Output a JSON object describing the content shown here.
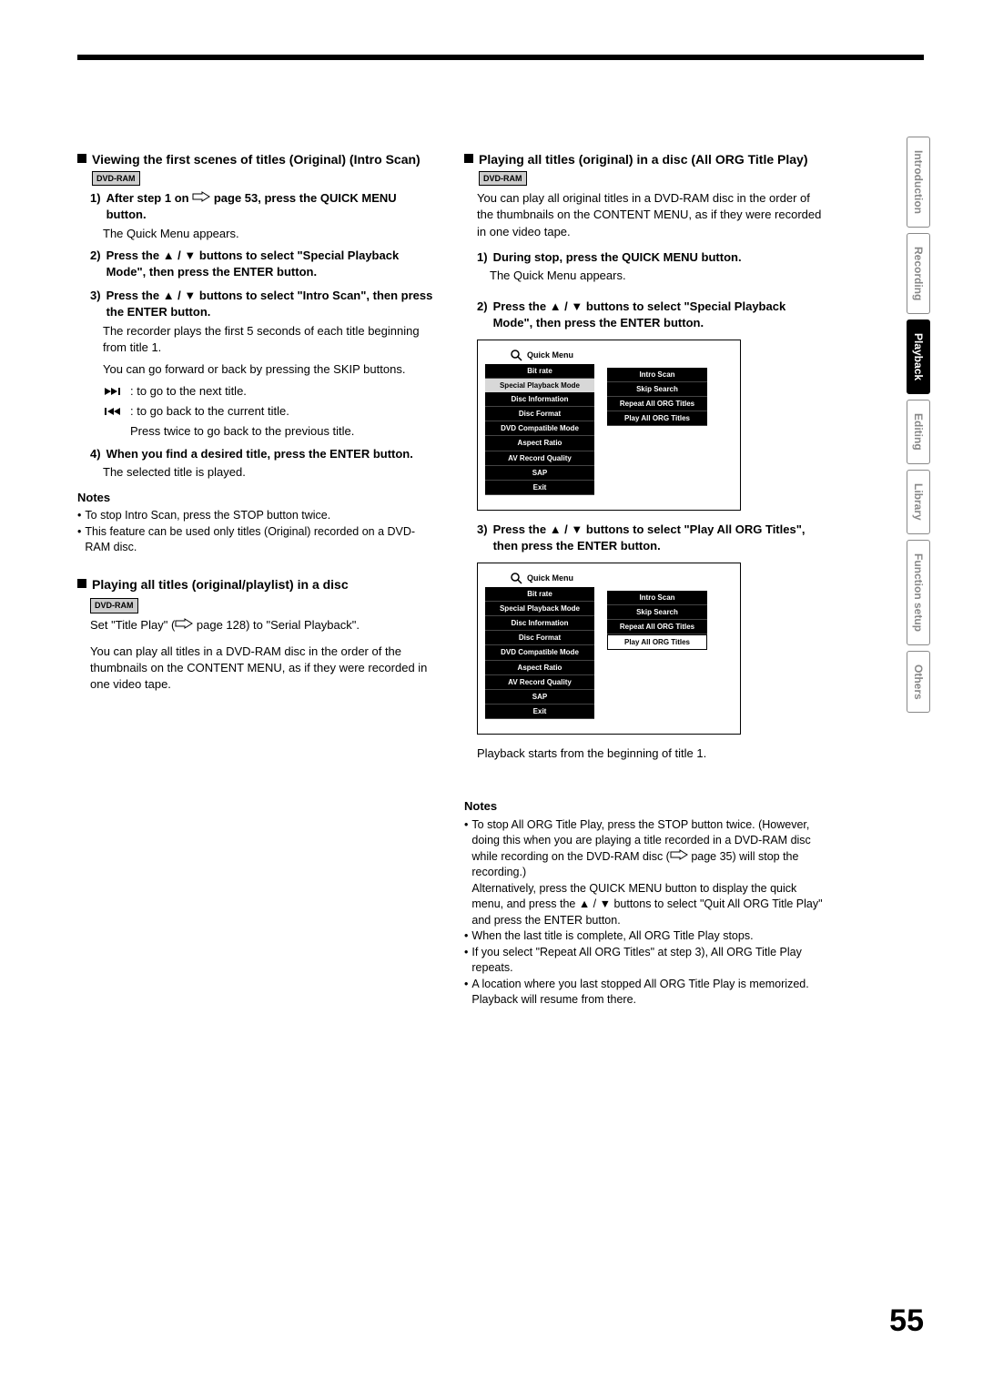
{
  "pageNumber": "55",
  "sideTabs": {
    "intro": "Introduction",
    "rec": "Recording",
    "play": "Playback",
    "edit": "Editing",
    "lib": "Library",
    "func": "Function setup",
    "oth": "Others"
  },
  "badge_dvdram": "DVD-RAM",
  "left": {
    "h1": "Viewing the first scenes of titles (Original) (Intro Scan)",
    "s1n": "1)",
    "s1a": "After step 1 on",
    "s1b": " page 53, press the QUICK MENU button.",
    "s1f": "The Quick Menu appears.",
    "s2n": "2)",
    "s2": "Press the ▲ / ▼ buttons to select \"Special Playback Mode\", then press the ENTER button.",
    "s3n": "3)",
    "s3": "Press the ▲ / ▼ buttons to select \"Intro Scan\", then press the ENTER button.",
    "s3f1": "The recorder plays the first 5 seconds of each title beginning from title 1.",
    "s3f2": "You can go forward or back by pressing the SKIP buttons.",
    "fwd": ": to go to the next title.",
    "bwd": ": to go back to the current title.",
    "bwd2": "Press twice to go back to the previous title.",
    "s4n": "4)",
    "s4": "When you find a desired title, press the ENTER button.",
    "s4f": "The selected title is played.",
    "notes_h": "Notes",
    "n1": "To stop Intro Scan, press the STOP button twice.",
    "n2": "This feature can be used only titles (Original) recorded on a DVD-RAM disc.",
    "h2": "Playing all titles (original/playlist) in a disc",
    "h2a": "Set \"Title Play\" (",
    "h2b": " page 128) to \"Serial Playback\".",
    "h2p": "You can play all titles in a DVD-RAM disc in the order of the thumbnails on the CONTENT MENU, as if they were recorded in one video tape."
  },
  "right": {
    "h1": "Playing all titles (original) in a disc (All ORG Title Play)",
    "intro": "You can play all original titles in a DVD-RAM disc in the order of the thumbnails on the CONTENT MENU, as if they were recorded in one video tape.",
    "s1n": "1)",
    "s1": "During stop, press the QUICK MENU button.",
    "s1f": "The Quick Menu appears.",
    "s2n": "2)",
    "s2": "Press the ▲ / ▼ buttons to select \"Special Playback Mode\", then press the ENTER button.",
    "s3n": "3)",
    "s3": "Press the ▲ / ▼ buttons to select \"Play All ORG Titles\", then press the ENTER button.",
    "playstart": "Playback starts from the beginning of title 1.",
    "notes_h": "Notes",
    "n1a": "To stop All ORG Title Play, press the STOP button twice. (However, doing this when you are playing a title recorded in a DVD-RAM disc while recording on the DVD-RAM disc (",
    "n1b": " page 35) will stop the recording.)",
    "n1c": "Alternatively, press the QUICK MENU button to display the quick menu, and press the ▲ / ▼ buttons to select \"Quit All ORG Title Play\" and press the ENTER button.",
    "n2": "When the last title is complete, All ORG Title Play stops.",
    "n3": "If you select \"Repeat All ORG Titles\" at step 3), All ORG Title Play repeats.",
    "n4": "A location where you last stopped All ORG Title Play is memorized. Playback will resume from there."
  },
  "menu": {
    "title": "Quick Menu",
    "bitrate": "Bit rate",
    "spb": "Special Playback Mode",
    "di": "Disc Information",
    "df": "Disc Format",
    "dcm": "DVD Compatible Mode",
    "ar": "Aspect Ratio",
    "avrq": "AV Record Quality",
    "sap": "SAP",
    "exit": "Exit",
    "intro": "Intro Scan",
    "skip": "Skip Search",
    "rep": "Repeat All ORG Titles",
    "play": "Play All ORG Titles"
  }
}
